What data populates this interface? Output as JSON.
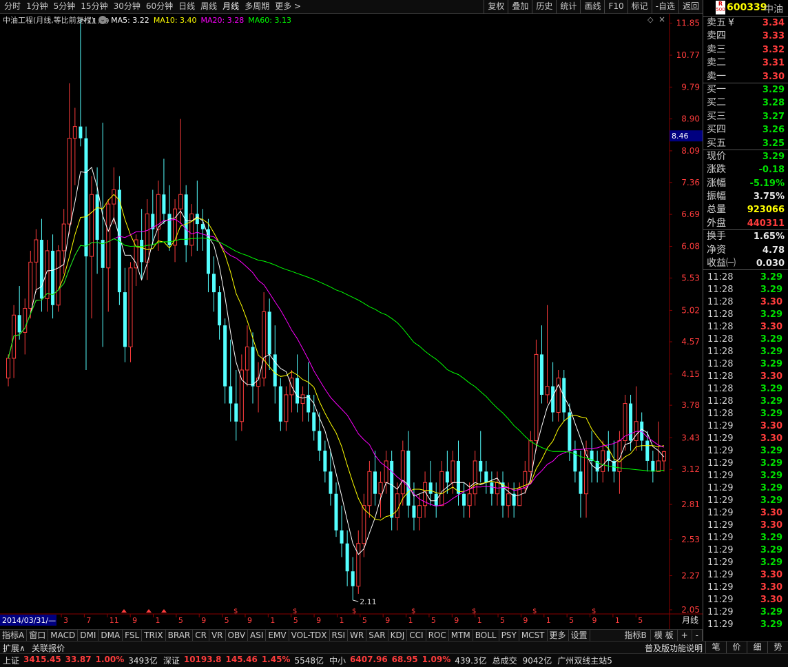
{
  "toolbar": {
    "period_tabs": [
      "分时",
      "1分钟",
      "5分钟",
      "15分钟",
      "30分钟",
      "60分钟",
      "日线",
      "周线",
      "月线",
      "多周期",
      "更多 >"
    ],
    "active_tab": "月线",
    "buttons": [
      "复权",
      "叠加",
      "历史",
      "统计",
      "画线",
      "F10",
      "标记",
      "-自选",
      "返回"
    ]
  },
  "chart_header": {
    "title": "中油工程(月线,等比前复权)",
    "ma": [
      {
        "label": "MA5: 3.22",
        "color": "#ffffff"
      },
      {
        "label": "MA10: 3.40",
        "color": "#ffff00"
      },
      {
        "label": "MA20: 3.28",
        "color": "#ff00ff"
      },
      {
        "label": "MA60: 3.13",
        "color": "#00ff00"
      }
    ],
    "max_label": "11.99",
    "min_label": "2.11"
  },
  "price_axis": {
    "ticks": [
      "11.85",
      "10.77",
      "9.79",
      "8.90",
      "8.09",
      "7.36",
      "6.69",
      "6.08",
      "5.53",
      "5.02",
      "4.57",
      "4.15",
      "3.78",
      "3.43",
      "3.12",
      "2.81",
      "2.53",
      "2.27",
      "2.05"
    ],
    "current_box": "8.46"
  },
  "time_axis": {
    "start_label": "2014/03/31/—",
    "labels": [
      "3",
      "7",
      "11",
      "9",
      "1",
      "5",
      "9",
      "5",
      "9",
      "1",
      "5",
      "9",
      "1",
      "5",
      "9",
      "1",
      "5",
      "9",
      "1",
      "5",
      "9",
      "1",
      "5",
      "9",
      "1",
      "5"
    ],
    "period_label": "月线"
  },
  "chart_data": {
    "type": "candlestick",
    "series_names": [
      "MA5",
      "MA10",
      "MA20",
      "MA60"
    ],
    "ylim": [
      2.05,
      11.99
    ],
    "log_scale": true,
    "candles": [
      [
        4.1,
        4.4,
        4.0,
        4.35
      ],
      [
        4.35,
        5.1,
        4.1,
        4.95
      ],
      [
        4.95,
        5.4,
        4.6,
        4.7
      ],
      [
        4.7,
        5.2,
        4.4,
        5.05
      ],
      [
        5.05,
        6.0,
        4.9,
        5.8
      ],
      [
        5.8,
        6.4,
        5.3,
        6.2
      ],
      [
        6.2,
        6.6,
        5.0,
        5.2
      ],
      [
        5.2,
        6.2,
        5.0,
        6.0
      ],
      [
        6.0,
        6.3,
        4.9,
        5.1
      ],
      [
        5.1,
        6.1,
        5.0,
        6.0
      ],
      [
        6.0,
        6.8,
        5.6,
        6.5
      ],
      [
        6.5,
        9.9,
        6.3,
        8.4
      ],
      [
        8.4,
        9.2,
        7.3,
        8.7
      ],
      [
        8.7,
        11.99,
        8.2,
        8.4
      ],
      [
        8.4,
        8.7,
        4.2,
        5.9
      ],
      [
        5.9,
        7.5,
        4.9,
        7.1
      ],
      [
        7.1,
        7.7,
        5.6,
        6.2
      ],
      [
        6.2,
        8.8,
        4.5,
        5.7
      ],
      [
        5.7,
        7.0,
        5.0,
        6.9
      ],
      [
        6.9,
        7.7,
        6.5,
        7.2
      ],
      [
        7.2,
        7.5,
        5.1,
        5.3
      ],
      [
        5.3,
        5.7,
        4.3,
        4.5
      ],
      [
        4.5,
        5.8,
        4.3,
        5.7
      ],
      [
        5.7,
        6.3,
        5.4,
        6.2
      ],
      [
        6.2,
        6.8,
        5.5,
        5.8
      ],
      [
        5.8,
        7.0,
        5.5,
        6.7
      ],
      [
        6.7,
        7.2,
        6.1,
        6.4
      ],
      [
        6.4,
        7.4,
        6.0,
        7.1
      ],
      [
        7.1,
        7.9,
        6.5,
        6.7
      ],
      [
        6.7,
        7.3,
        6.0,
        6.1
      ],
      [
        6.1,
        7.0,
        5.8,
        6.8
      ],
      [
        6.8,
        8.9,
        6.5,
        7.1
      ],
      [
        7.1,
        7.3,
        5.8,
        6.1
      ],
      [
        6.1,
        6.9,
        5.9,
        6.7
      ],
      [
        6.7,
        7.4,
        6.0,
        6.5
      ],
      [
        6.5,
        6.8,
        6.0,
        6.4
      ],
      [
        6.4,
        6.6,
        5.3,
        5.6
      ],
      [
        5.6,
        5.9,
        5.0,
        5.3
      ],
      [
        5.3,
        5.4,
        4.6,
        4.8
      ],
      [
        4.8,
        4.9,
        3.8,
        4.0
      ],
      [
        4.0,
        4.6,
        3.6,
        3.8
      ],
      [
        3.8,
        4.2,
        3.4,
        3.6
      ],
      [
        3.6,
        4.4,
        3.5,
        4.2
      ],
      [
        4.2,
        4.8,
        4.0,
        4.5
      ],
      [
        4.5,
        4.7,
        3.8,
        4.0
      ],
      [
        4.0,
        4.3,
        3.7,
        4.1
      ],
      [
        4.1,
        5.3,
        4.0,
        5.0
      ],
      [
        5.0,
        5.2,
        4.2,
        4.4
      ],
      [
        4.4,
        4.8,
        3.8,
        4.0
      ],
      [
        4.0,
        4.1,
        3.5,
        3.6
      ],
      [
        3.6,
        4.0,
        3.5,
        3.9
      ],
      [
        3.9,
        4.2,
        3.7,
        4.1
      ],
      [
        4.1,
        4.4,
        3.7,
        3.8
      ],
      [
        3.8,
        4.0,
        3.6,
        3.9
      ],
      [
        3.9,
        4.3,
        3.6,
        3.7
      ],
      [
        3.7,
        3.9,
        3.4,
        3.5
      ],
      [
        3.5,
        3.7,
        3.2,
        3.3
      ],
      [
        3.3,
        3.4,
        3.0,
        3.1
      ],
      [
        3.1,
        3.3,
        2.8,
        2.9
      ],
      [
        2.9,
        3.0,
        2.55,
        2.6
      ],
      [
        2.6,
        2.8,
        2.4,
        2.5
      ],
      [
        2.5,
        2.6,
        2.2,
        2.3
      ],
      [
        2.3,
        2.4,
        2.11,
        2.2
      ],
      [
        2.2,
        2.6,
        2.15,
        2.5
      ],
      [
        2.5,
        2.9,
        2.4,
        2.8
      ],
      [
        2.8,
        3.2,
        2.7,
        3.1
      ],
      [
        3.1,
        3.3,
        2.8,
        2.9
      ],
      [
        2.9,
        3.1,
        2.7,
        3.0
      ],
      [
        3.0,
        3.3,
        2.9,
        3.2
      ],
      [
        3.2,
        3.3,
        2.6,
        2.7
      ],
      [
        2.7,
        3.0,
        2.6,
        2.9
      ],
      [
        2.9,
        3.4,
        2.8,
        3.3
      ],
      [
        3.3,
        3.5,
        2.7,
        2.8
      ],
      [
        2.8,
        3.0,
        2.6,
        2.7
      ],
      [
        2.7,
        2.9,
        2.6,
        2.8
      ],
      [
        2.8,
        3.1,
        2.7,
        3.0
      ],
      [
        3.0,
        3.2,
        2.8,
        2.9
      ],
      [
        2.9,
        3.0,
        2.7,
        2.8
      ],
      [
        2.8,
        3.2,
        2.8,
        3.1
      ],
      [
        3.1,
        3.3,
        2.9,
        3.0
      ],
      [
        3.0,
        3.3,
        2.9,
        3.2
      ],
      [
        3.2,
        3.4,
        2.8,
        2.9
      ],
      [
        2.9,
        3.0,
        2.7,
        2.8
      ],
      [
        2.8,
        3.0,
        2.7,
        2.9
      ],
      [
        2.9,
        3.3,
        2.8,
        3.2
      ],
      [
        3.2,
        3.5,
        3.0,
        3.1
      ],
      [
        3.1,
        3.2,
        2.9,
        3.0
      ],
      [
        3.0,
        3.1,
        2.8,
        2.9
      ],
      [
        2.9,
        3.1,
        2.8,
        3.0
      ],
      [
        3.0,
        3.1,
        2.7,
        2.8
      ],
      [
        2.8,
        3.0,
        2.7,
        2.9
      ],
      [
        2.9,
        3.0,
        2.7,
        2.8
      ],
      [
        2.8,
        3.0,
        2.8,
        2.95
      ],
      [
        2.95,
        3.2,
        2.9,
        3.1
      ],
      [
        3.1,
        3.5,
        3.0,
        3.4
      ],
      [
        3.4,
        4.6,
        3.3,
        4.4
      ],
      [
        4.4,
        4.8,
        3.8,
        3.9
      ],
      [
        3.9,
        5.1,
        3.8,
        4.0
      ],
      [
        4.0,
        4.3,
        3.6,
        3.7
      ],
      [
        3.7,
        4.2,
        3.6,
        4.1
      ],
      [
        4.1,
        4.2,
        3.6,
        3.7
      ],
      [
        3.7,
        3.8,
        3.2,
        3.3
      ],
      [
        3.3,
        3.4,
        3.0,
        3.1
      ],
      [
        3.1,
        3.3,
        2.7,
        2.9
      ],
      [
        2.9,
        3.4,
        2.7,
        3.3
      ],
      [
        3.3,
        3.5,
        3.0,
        3.2
      ],
      [
        3.2,
        3.3,
        3.0,
        3.1
      ],
      [
        3.1,
        3.4,
        3.0,
        3.3
      ],
      [
        3.3,
        3.5,
        3.1,
        3.2
      ],
      [
        3.2,
        3.4,
        3.0,
        3.1
      ],
      [
        3.1,
        3.5,
        2.9,
        3.4
      ],
      [
        3.4,
        3.9,
        3.3,
        3.8
      ],
      [
        3.8,
        3.9,
        3.3,
        3.4
      ],
      [
        3.4,
        4.0,
        3.3,
        3.6
      ],
      [
        3.6,
        3.7,
        3.3,
        3.4
      ],
      [
        3.4,
        3.5,
        3.1,
        3.2
      ],
      [
        3.2,
        3.3,
        3.0,
        3.1
      ],
      [
        3.1,
        3.6,
        3.1,
        3.2
      ],
      [
        3.2,
        3.3,
        3.1,
        3.29
      ]
    ]
  },
  "right_panel": {
    "code": "600339",
    "name": "中油",
    "r_badge_top": "R",
    "r_badge_bot": "500",
    "order_book": [
      {
        "label": "卖五",
        "mark": "¥",
        "price": "3.34",
        "color": "#ff3c3c"
      },
      {
        "label": "卖四",
        "mark": "",
        "price": "3.33",
        "color": "#ff3c3c"
      },
      {
        "label": "卖三",
        "mark": "",
        "price": "3.32",
        "color": "#ff3c3c"
      },
      {
        "label": "卖二",
        "mark": "",
        "price": "3.31",
        "color": "#ff3c3c"
      },
      {
        "label": "卖一",
        "mark": "",
        "price": "3.30",
        "color": "#ff3c3c"
      },
      {
        "label": "买一",
        "mark": "",
        "price": "3.29",
        "color": "#00e000"
      },
      {
        "label": "买二",
        "mark": "",
        "price": "3.28",
        "color": "#00e000"
      },
      {
        "label": "买三",
        "mark": "",
        "price": "3.27",
        "color": "#00e000"
      },
      {
        "label": "买四",
        "mark": "",
        "price": "3.26",
        "color": "#00e000"
      },
      {
        "label": "买五",
        "mark": "",
        "price": "3.25",
        "color": "#00e000"
      }
    ],
    "quote": [
      {
        "label": "现价",
        "value": "3.29",
        "color": "#00e000"
      },
      {
        "label": "涨跌",
        "value": "-0.18",
        "color": "#00e000"
      },
      {
        "label": "涨幅",
        "value": "-5.19%",
        "color": "#00e000"
      },
      {
        "label": "振幅",
        "value": "3.75%",
        "color": "#e8e8e8"
      },
      {
        "label": "总量",
        "value": "923066",
        "color": "#ffff00"
      },
      {
        "label": "外盘",
        "value": "440311",
        "color": "#ff3c3c"
      }
    ],
    "fund": [
      {
        "label": "换手",
        "value": "1.65%",
        "color": "#e8e8e8"
      },
      {
        "label": "净资",
        "value": "4.78",
        "color": "#e8e8e8"
      },
      {
        "label": "收益㈠",
        "value": "0.030",
        "color": "#e8e8e8"
      }
    ],
    "ticks": [
      {
        "time": "11:28",
        "price": "3.29",
        "color": "#00e000"
      },
      {
        "time": "11:28",
        "price": "3.29",
        "color": "#00e000"
      },
      {
        "time": "11:28",
        "price": "3.30",
        "color": "#ff3c3c"
      },
      {
        "time": "11:28",
        "price": "3.29",
        "color": "#00e000"
      },
      {
        "time": "11:28",
        "price": "3.30",
        "color": "#ff3c3c"
      },
      {
        "time": "11:28",
        "price": "3.29",
        "color": "#00e000"
      },
      {
        "time": "11:28",
        "price": "3.29",
        "color": "#00e000"
      },
      {
        "time": "11:28",
        "price": "3.29",
        "color": "#00e000"
      },
      {
        "time": "11:28",
        "price": "3.30",
        "color": "#ff3c3c"
      },
      {
        "time": "11:28",
        "price": "3.29",
        "color": "#00e000"
      },
      {
        "time": "11:28",
        "price": "3.29",
        "color": "#00e000"
      },
      {
        "time": "11:28",
        "price": "3.29",
        "color": "#00e000"
      },
      {
        "time": "11:29",
        "price": "3.30",
        "color": "#ff3c3c"
      },
      {
        "time": "11:29",
        "price": "3.30",
        "color": "#ff3c3c"
      },
      {
        "time": "11:29",
        "price": "3.29",
        "color": "#00e000"
      },
      {
        "time": "11:29",
        "price": "3.29",
        "color": "#00e000"
      },
      {
        "time": "11:29",
        "price": "3.29",
        "color": "#00e000"
      },
      {
        "time": "11:29",
        "price": "3.29",
        "color": "#00e000"
      },
      {
        "time": "11:29",
        "price": "3.29",
        "color": "#00e000"
      },
      {
        "time": "11:29",
        "price": "3.30",
        "color": "#ff3c3c"
      },
      {
        "time": "11:29",
        "price": "3.30",
        "color": "#ff3c3c"
      },
      {
        "time": "11:29",
        "price": "3.29",
        "color": "#00e000"
      },
      {
        "time": "11:29",
        "price": "3.29",
        "color": "#00e000"
      },
      {
        "time": "11:29",
        "price": "3.29",
        "color": "#00e000"
      },
      {
        "time": "11:29",
        "price": "3.30",
        "color": "#ff3c3c"
      },
      {
        "time": "11:29",
        "price": "3.30",
        "color": "#ff3c3c"
      },
      {
        "time": "11:29",
        "price": "3.30",
        "color": "#ff3c3c"
      },
      {
        "time": "11:29",
        "price": "3.29",
        "color": "#00e000"
      },
      {
        "time": "11:29",
        "price": "3.29",
        "color": "#00e000"
      }
    ]
  },
  "indicator_bar": {
    "items": [
      "指标A",
      "窗口",
      "MACD",
      "DMI",
      "DMA",
      "FSL",
      "TRIX",
      "BRAR",
      "CR",
      "VR",
      "OBV",
      "ASI",
      "EMV",
      "VOL-TDX",
      "RSI",
      "WR",
      "SAR",
      "KDJ",
      "CCI",
      "ROC",
      "MTM",
      "BOLL",
      "PSY",
      "MCST",
      "更多",
      "设置"
    ],
    "right_items": [
      "指标B",
      "模 板",
      "+",
      "-"
    ]
  },
  "bottom_bar": {
    "left": "扩展∧",
    "left2": "关联报价",
    "right_label": "普及版功能说明",
    "tabs": [
      "笔",
      "价",
      "细",
      "势"
    ]
  },
  "status_bar": {
    "items": [
      {
        "name": "上证",
        "value": "3415.45",
        "change": "33.87",
        "pct": "1.00%",
        "amount": "3493亿",
        "color": "#ff3c3c"
      },
      {
        "name": "深证",
        "value": "10193.8",
        "change": "145.46",
        "pct": "1.45%",
        "amount": "5548亿",
        "color": "#ff3c3c"
      },
      {
        "name": "中小",
        "value": "6407.96",
        "change": "68.95",
        "pct": "1.09%",
        "amount": "439.3亿",
        "color": "#ff3c3c"
      }
    ],
    "total_label": "总成交",
    "total_value": "9042亿",
    "server": "广州双线主站5"
  }
}
